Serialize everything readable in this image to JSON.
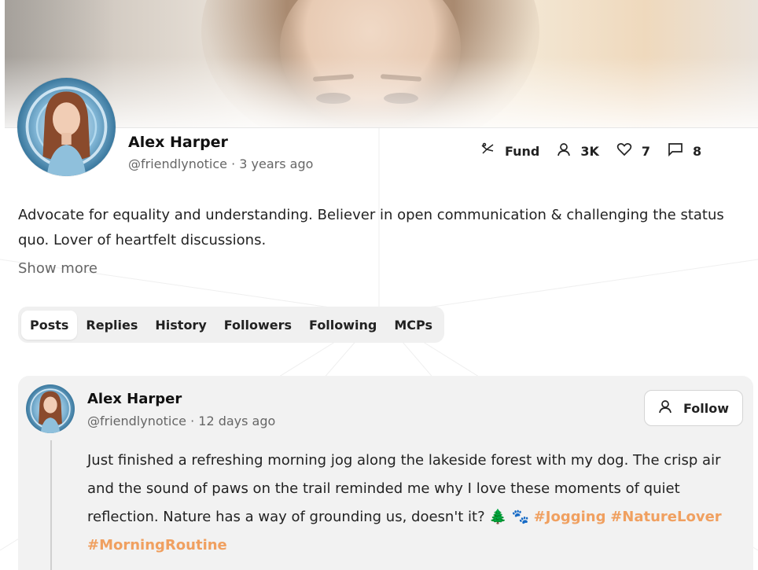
{
  "profile": {
    "name": "Alex Harper",
    "handle_time": "@friendlynotice · 3 years ago",
    "bio": "Advocate for equality and understanding. Believer in open communication & challenging the status quo. Lover of heartfelt discussions.",
    "show_more": "Show more"
  },
  "stats": {
    "fund_label": "Fund",
    "followers": "3K",
    "likes": "7",
    "comments": "8"
  },
  "tabs": [
    "Posts",
    "Replies",
    "History",
    "Followers",
    "Following",
    "MCPs"
  ],
  "active_tab": "Posts",
  "post": {
    "author": "Alex Harper",
    "handle_time": "@friendlynotice · 12 days ago",
    "follow_label": "Follow",
    "text": "Just finished a refreshing morning jog along the lakeside forest with my dog. The crisp air and the sound of paws on the trail reminded me why I love these moments of quiet reflection. Nature has a way of grounding us, doesn't it? 🌲 🐾 ",
    "hashtags": [
      "#Jogging",
      "#NatureLover",
      "#MorningRoutine"
    ]
  },
  "colors": {
    "hashtag": "#f0a060",
    "card_bg": "#f2f2f2",
    "tabs_bg": "#f0f0f0"
  },
  "icons": [
    "fund-icon",
    "user-icon",
    "heart-icon",
    "comment-icon"
  ]
}
